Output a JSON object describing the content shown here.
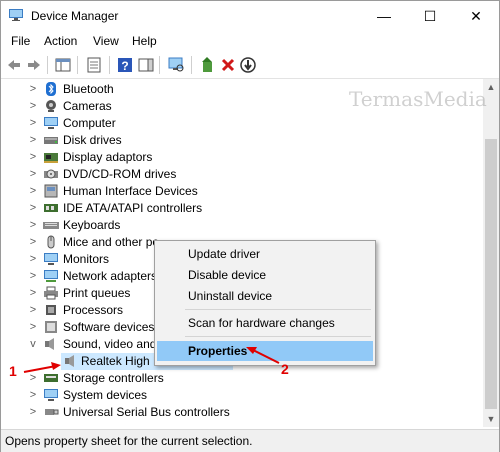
{
  "window": {
    "title": "Device Manager",
    "controls": {
      "minimize": "—",
      "maximize": "☐",
      "close": "✕"
    }
  },
  "menubar": [
    "File",
    "Action",
    "View",
    "Help"
  ],
  "toolbar": {
    "icons": [
      "back-icon",
      "forward-icon",
      "show-hide-console-tree-icon",
      "properties-icon",
      "help-icon",
      "action-pane-icon",
      "scan-hardware-icon",
      "update-driver-icon",
      "uninstall-icon",
      "disable-device-icon"
    ]
  },
  "tree": {
    "items": [
      {
        "label": "Bluetooth",
        "icon": "bluetooth-icon"
      },
      {
        "label": "Cameras",
        "icon": "camera-icon"
      },
      {
        "label": "Computer",
        "icon": "computer-icon"
      },
      {
        "label": "Disk drives",
        "icon": "disk-drive-icon"
      },
      {
        "label": "Display adaptors",
        "icon": "display-adapter-icon"
      },
      {
        "label": "DVD/CD-ROM drives",
        "icon": "dvd-icon"
      },
      {
        "label": "Human Interface Devices",
        "icon": "hid-icon"
      },
      {
        "label": "IDE ATA/ATAPI controllers",
        "icon": "ide-icon"
      },
      {
        "label": "Keyboards",
        "icon": "keyboard-icon"
      },
      {
        "label": "Mice and other po",
        "icon": "mouse-icon"
      },
      {
        "label": "Monitors",
        "icon": "monitor-icon"
      },
      {
        "label": "Network adapters",
        "icon": "network-icon"
      },
      {
        "label": "Print queues",
        "icon": "printer-icon"
      },
      {
        "label": "Processors",
        "icon": "processor-icon"
      },
      {
        "label": "Software devices",
        "icon": "software-device-icon"
      },
      {
        "label": "Sound, video and",
        "icon": "sound-icon",
        "expanded": true
      },
      {
        "label": "Storage controllers",
        "icon": "storage-icon"
      },
      {
        "label": "System devices",
        "icon": "system-device-icon"
      },
      {
        "label": "Universal Serial Bus controllers",
        "icon": "usb-icon"
      }
    ],
    "selected_child": {
      "label": "Realtek High Definition Audio",
      "icon": "speaker-icon"
    }
  },
  "context_menu": {
    "items": [
      "Update driver",
      "Disable device",
      "Uninstall device",
      "Scan for hardware changes",
      "Properties"
    ],
    "highlighted": "Properties"
  },
  "status_bar": {
    "text": "Opens property sheet for the current selection."
  },
  "watermark": "TermasMedia",
  "annotations": {
    "step1": "1",
    "step2": "2"
  },
  "colors": {
    "selection": "#cce8ff",
    "menu_highlight": "#91c9f7",
    "annotation": "#e00000"
  }
}
